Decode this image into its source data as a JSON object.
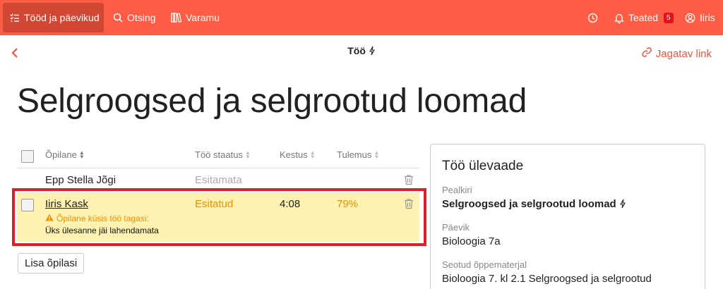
{
  "nav": {
    "items": [
      {
        "label": "Tööd ja päevikud",
        "icon": "checklist-icon",
        "active": true
      },
      {
        "label": "Otsing",
        "icon": "search-icon"
      },
      {
        "label": "Varamu",
        "icon": "library-icon"
      }
    ],
    "notifications_label": "Teated",
    "notifications_count": "5",
    "user_label": "Iiris"
  },
  "header": {
    "title": "Töö",
    "share_label": "Jagatav link"
  },
  "page_title": "Selgroogsed ja selgrootud loomad",
  "table": {
    "columns": [
      "Õpilane",
      "Töö staatus",
      "Kestus",
      "Tulemus"
    ],
    "rows": [
      {
        "student": "Epp Stella Jõgi",
        "status": "Esitamata",
        "duration": "",
        "result": ""
      },
      {
        "student": "Iiris Kask",
        "status": "Esitatud",
        "duration": "4:08",
        "result": "79%",
        "warning": "Õpilane küsis töö tagasi:",
        "reason": "Üks ülesanne jäi lahendamata"
      }
    ],
    "add_student_label": "Lisa õpilasi"
  },
  "overview": {
    "title": "Töö ülevaade",
    "fields": [
      {
        "label": "Pealkiri",
        "value": "Selgroogsed ja selgrootud loomad"
      },
      {
        "label": "Päevik",
        "value": "Bioloogia 7a"
      },
      {
        "label": "Seotud õppematerjal",
        "value": "Bioloogia 7. kl 2.1 Selgroogsed ja selgrootud"
      }
    ]
  },
  "colors": {
    "topbar": "#fd5c45",
    "accent": "#f1543f",
    "status_submitted": "#f29100",
    "highlight_row": "#fdf2b1",
    "highlight_border": "#e11d2a"
  }
}
